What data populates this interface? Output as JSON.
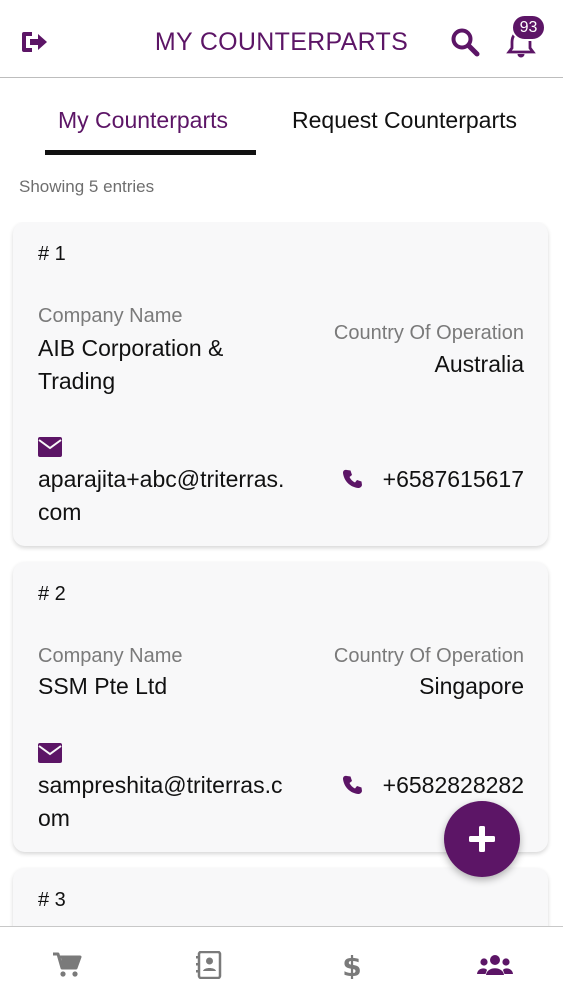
{
  "header": {
    "title": "MY COUNTERPARTS",
    "notification_count": "93"
  },
  "tabs": [
    {
      "label": "My Counterparts",
      "active": true
    },
    {
      "label": "Request Counterparts",
      "active": false
    }
  ],
  "summary": "Showing 5 entries",
  "labels": {
    "company": "Company Name",
    "country": "Country Of Operation"
  },
  "counterparts": [
    {
      "number": "# 1",
      "company_line1": "AIB Corporation &",
      "company_line2": "Trading",
      "country": "Australia",
      "email_line1": "aparajita+abc@triterras.",
      "email_line2": "com",
      "phone": "+6587615617"
    },
    {
      "number": "# 2",
      "company_line1": "SSM Pte Ltd",
      "company_line2": "",
      "country": "Singapore",
      "email_line1": "sampreshita@triterras.c",
      "email_line2": "om",
      "phone": "+6582828282"
    },
    {
      "number": "# 3"
    }
  ],
  "colors": {
    "accent": "#5c1566",
    "card_bg": "#f8f8f9"
  },
  "icons": {
    "logout": "logout-icon",
    "search": "search-icon",
    "bell": "bell-icon",
    "mail": "envelope-icon",
    "phone": "phone-icon",
    "fab": "plus-icon",
    "nav": [
      "cart-icon",
      "contacts-icon",
      "dollar-icon",
      "users-icon"
    ]
  }
}
